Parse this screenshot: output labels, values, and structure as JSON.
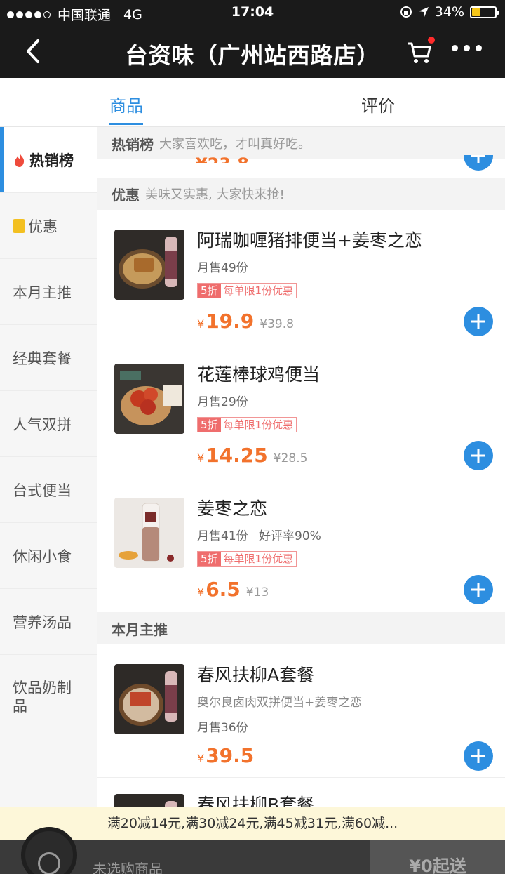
{
  "status_bar": {
    "carrier": "中国联通",
    "network": "4G",
    "time": "17:04",
    "battery": "34%",
    "battery_level": 0.34
  },
  "header": {
    "title": "台资味（广州站西路店）",
    "back_icon": "chevron-left-icon",
    "cart_icon": "cart-icon",
    "more_icon": "more-dots-icon"
  },
  "tabs": {
    "goods": "商品",
    "reviews": "评价"
  },
  "sidebar": {
    "items": [
      {
        "label": "热销榜",
        "icon": "flame-icon"
      },
      {
        "label": "优惠",
        "icon": "coupon-icon"
      },
      {
        "label": "本月主推"
      },
      {
        "label": "经典套餐"
      },
      {
        "label": "人气双拼"
      },
      {
        "label": "台式便当"
      },
      {
        "label": "休闲小食"
      },
      {
        "label": "营养汤品"
      },
      {
        "label": "饮品奶制品"
      }
    ]
  },
  "sections": {
    "hot": {
      "name": "热销榜",
      "desc": "大家喜欢吃，才叫真好吃。"
    },
    "discount": {
      "name": "优惠",
      "desc": "美味又实惠, 大家快来抢!"
    },
    "monthly": {
      "name": "本月主推"
    }
  },
  "items": [
    {
      "title": "阿瑞咖喱猪排便当+姜枣之恋",
      "sold": "月售49份",
      "discount": "5折",
      "limit": "每单限1份优惠",
      "yen": "¥",
      "price": "19.9",
      "old_price": "¥39.8"
    },
    {
      "title": "花莲棒球鸡便当",
      "sold": "月售29份",
      "discount": "5折",
      "limit": "每单限1份优惠",
      "yen": "¥",
      "price": "14.25",
      "old_price": "¥28.5"
    },
    {
      "title": "姜枣之恋",
      "sold": "月售41份",
      "rating": "好评率90%",
      "discount": "5折",
      "limit": "每单限1份优惠",
      "yen": "¥",
      "price": "6.5",
      "old_price": "¥13"
    },
    {
      "title": "春风扶柳A套餐",
      "subtitle": "奥尔良卤肉双拼便当+姜枣之恋",
      "sold": "月售36份",
      "yen": "¥",
      "price": "39.5"
    },
    {
      "title": "春风扶柳B套餐"
    }
  ],
  "banner": {
    "text": "满20减14元,满30减24元,满45减31元,满60减..."
  },
  "bottom_bar": {
    "empty_text": "未选购商品",
    "checkout_text": "¥0起送"
  },
  "colors": {
    "accent": "#2d8ee0",
    "price": "#f2722c",
    "promo": "#ef6d6d",
    "header_bg": "#1a1a1a"
  }
}
